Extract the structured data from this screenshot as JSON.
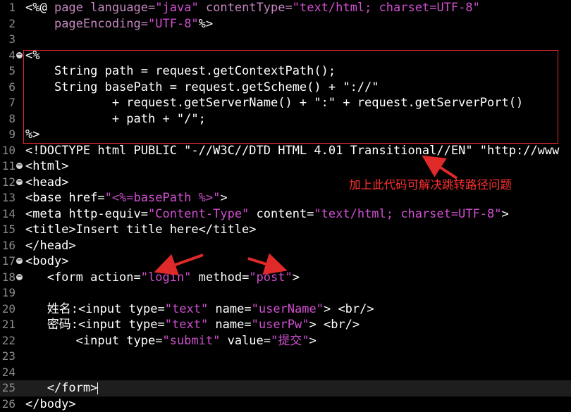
{
  "editor": {
    "lines": [
      {
        "n": "1",
        "fold": false,
        "tokens": [
          [
            "w",
            "<%@ "
          ],
          [
            "k",
            "page "
          ],
          [
            "k",
            "language="
          ],
          [
            "s",
            "\"java\""
          ],
          [
            "k",
            " contentType="
          ],
          [
            "s",
            "\"text/html; charset=UTF-8\""
          ]
        ]
      },
      {
        "n": "2",
        "fold": false,
        "tokens": [
          [
            "w",
            "    "
          ],
          [
            "k",
            "pageEncoding="
          ],
          [
            "s",
            "\"UTF-8\""
          ],
          [
            "w",
            "%>"
          ]
        ]
      },
      {
        "n": "3",
        "fold": false,
        "tokens": []
      },
      {
        "n": "4",
        "fold": true,
        "tokens": [
          [
            "w",
            "<%"
          ]
        ]
      },
      {
        "n": "5",
        "fold": false,
        "tokens": [
          [
            "w",
            "    String path = request.getContextPath();"
          ]
        ]
      },
      {
        "n": "6",
        "fold": false,
        "tokens": [
          [
            "w",
            "    String basePath = request.getScheme() + \"://\""
          ]
        ]
      },
      {
        "n": "7",
        "fold": false,
        "tokens": [
          [
            "w",
            "            + request.getServerName() + \":\" + request.getServerPort()"
          ]
        ]
      },
      {
        "n": "8",
        "fold": false,
        "tokens": [
          [
            "w",
            "            + path + \"/\";"
          ]
        ]
      },
      {
        "n": "9",
        "fold": false,
        "tokens": [
          [
            "w",
            "%>"
          ]
        ]
      },
      {
        "n": "10",
        "fold": false,
        "tokens": [
          [
            "w",
            "<!DOCTYPE html PUBLIC \"-//W3C//DTD HTML 4.01 Transitional//EN\" \"http://www"
          ]
        ]
      },
      {
        "n": "11",
        "fold": true,
        "tokens": [
          [
            "w",
            "<html>"
          ]
        ]
      },
      {
        "n": "12",
        "fold": true,
        "tokens": [
          [
            "w",
            "<head>"
          ]
        ]
      },
      {
        "n": "13",
        "fold": false,
        "tokens": [
          [
            "w",
            "<base href="
          ],
          [
            "s",
            "\"<%=basePath %>\""
          ],
          [
            "w",
            ">"
          ]
        ]
      },
      {
        "n": "14",
        "fold": false,
        "tokens": [
          [
            "w",
            "<meta http-equiv="
          ],
          [
            "s",
            "\"Content-Type\""
          ],
          [
            "w",
            " content="
          ],
          [
            "s",
            "\"text/html; charset=UTF-8\""
          ],
          [
            "w",
            ">"
          ]
        ]
      },
      {
        "n": "15",
        "fold": false,
        "tokens": [
          [
            "w",
            "<title>Insert title here</title>"
          ]
        ]
      },
      {
        "n": "16",
        "fold": false,
        "tokens": [
          [
            "w",
            "</head>"
          ]
        ]
      },
      {
        "n": "17",
        "fold": true,
        "tokens": [
          [
            "w",
            "<body>"
          ]
        ]
      },
      {
        "n": "18",
        "fold": true,
        "tokens": [
          [
            "w",
            "   <form action="
          ],
          [
            "s",
            "\"login\""
          ],
          [
            "w",
            " method="
          ],
          [
            "s",
            "\"post\""
          ],
          [
            "w",
            ">"
          ]
        ]
      },
      {
        "n": "19",
        "fold": false,
        "tokens": []
      },
      {
        "n": "20",
        "fold": false,
        "tokens": [
          [
            "w",
            "   姓名:<input type="
          ],
          [
            "s",
            "\"text\""
          ],
          [
            "w",
            " name="
          ],
          [
            "s",
            "\"userName\""
          ],
          [
            "w",
            "> <br/>"
          ]
        ]
      },
      {
        "n": "21",
        "fold": false,
        "tokens": [
          [
            "w",
            "   密码:<input type="
          ],
          [
            "s",
            "\"text\""
          ],
          [
            "w",
            " name="
          ],
          [
            "s",
            "\"userPw\""
          ],
          [
            "w",
            "> <br/>"
          ]
        ]
      },
      {
        "n": "22",
        "fold": false,
        "tokens": [
          [
            "w",
            "       <input type="
          ],
          [
            "s",
            "\"submit\""
          ],
          [
            "w",
            " value="
          ],
          [
            "s",
            "\"提交\""
          ],
          [
            "w",
            ">"
          ]
        ]
      },
      {
        "n": "23",
        "fold": false,
        "tokens": []
      },
      {
        "n": "24",
        "fold": false,
        "tokens": []
      },
      {
        "n": "25",
        "fold": false,
        "current": true,
        "tokens": [
          [
            "w",
            "   </form>"
          ]
        ]
      },
      {
        "n": "26",
        "fold": false,
        "tokens": [
          [
            "w",
            "</body>"
          ]
        ]
      }
    ]
  },
  "annotation": {
    "note": "加上此代码可解决跳转路径问题",
    "color": "#e02a2a"
  }
}
